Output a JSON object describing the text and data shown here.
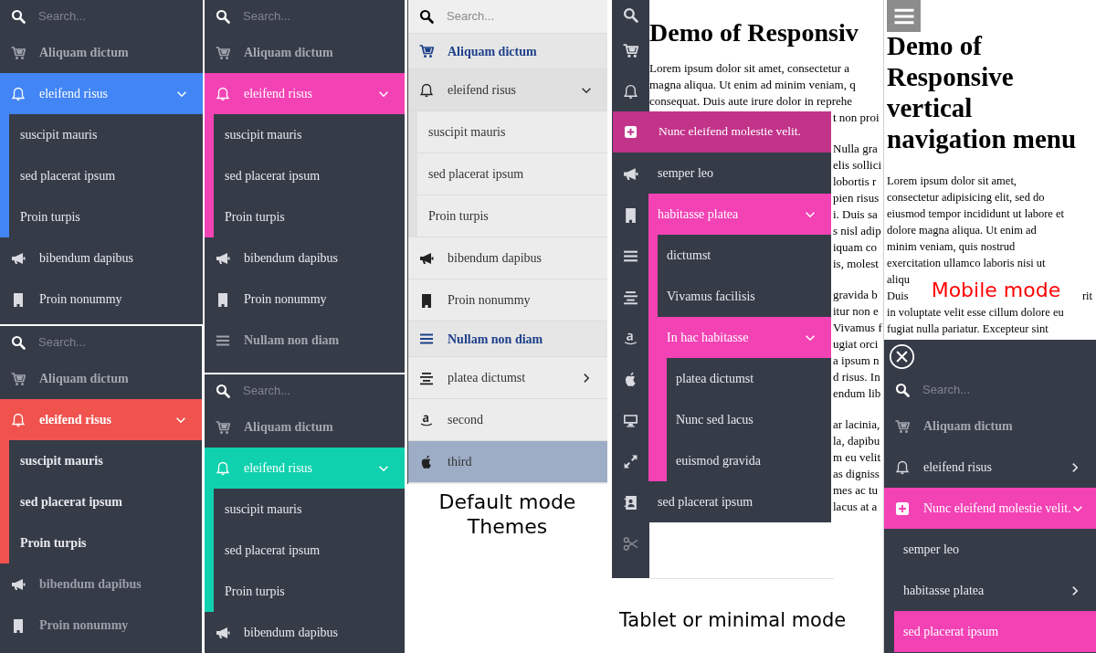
{
  "menus": [
    {
      "kind": "dark",
      "color": "#4285f4",
      "bold_text": false,
      "items": [
        {
          "kind": "search",
          "placeholder": "Search..."
        },
        {
          "kind": "header",
          "label": "Aliquam dictum"
        },
        {
          "kind": "link",
          "label": "eleifend risus",
          "expanded": true,
          "children": [
            {
              "label": "suscipit mauris"
            },
            {
              "label": "sed placerat ipsum"
            },
            {
              "label": "Proin turpis"
            }
          ]
        },
        {
          "kind": "link",
          "label": "bibendum dapibus"
        },
        {
          "kind": "link",
          "label": "Proin nonummy"
        }
      ]
    },
    {
      "kind": "dark",
      "color": "#f342b4",
      "bold_text": false,
      "items": [
        {
          "kind": "search",
          "placeholder": "Search..."
        },
        {
          "kind": "header",
          "label": "Aliquam dictum"
        },
        {
          "kind": "link",
          "label": "eleifend risus",
          "expanded": true,
          "children": [
            {
              "label": "suscipit mauris"
            },
            {
              "label": "sed placerat ipsum"
            },
            {
              "label": "Proin turpis"
            }
          ]
        },
        {
          "kind": "link",
          "label": "bibendum dapibus"
        },
        {
          "kind": "link",
          "label": "Proin nonummy"
        },
        {
          "kind": "header",
          "label": "Nullam non diam"
        }
      ]
    },
    {
      "kind": "dark",
      "color": "#f0534e",
      "bold_text": true,
      "items": [
        {
          "kind": "search",
          "placeholder": "Search..."
        },
        {
          "kind": "header",
          "label": "Aliquam dictum"
        },
        {
          "kind": "link",
          "label": "eleifend risus",
          "expanded": true,
          "children": [
            {
              "label": "suscipit mauris"
            },
            {
              "label": "sed placerat ipsum"
            },
            {
              "label": "Proin turpis"
            }
          ]
        },
        {
          "kind": "link",
          "label": "bibendum dapibus"
        },
        {
          "kind": "link",
          "label": "Proin nonummy"
        }
      ]
    },
    {
      "kind": "dark",
      "color": "#10d1ae",
      "bold_text": false,
      "items": [
        {
          "kind": "search",
          "placeholder": "Search..."
        },
        {
          "kind": "header",
          "label": "Aliquam dictum"
        },
        {
          "kind": "link",
          "label": "eleifend risus",
          "expanded": true,
          "children": [
            {
              "label": "suscipit mauris"
            },
            {
              "label": "sed placerat ipsum"
            },
            {
              "label": "Proin turpis"
            }
          ]
        },
        {
          "kind": "link",
          "label": "bibendum dapibus"
        }
      ]
    },
    {
      "kind": "light",
      "color": "#1d3f8a",
      "bold_text": false,
      "items": [
        {
          "kind": "search",
          "placeholder": "Search..."
        },
        {
          "kind": "header",
          "label": "Aliquam dictum"
        },
        {
          "kind": "link",
          "label": "eleifend risus",
          "expanded": true,
          "selected": false,
          "children": [
            {
              "label": "suscipit mauris",
              "selected": false
            },
            {
              "label": "sed placerat ipsum",
              "selected": false
            },
            {
              "label": "Proin turpis",
              "selected": false
            }
          ]
        },
        {
          "kind": "link",
          "label": "bibendum dapibus",
          "selected": false
        },
        {
          "kind": "link",
          "label": "Proin nonummy",
          "selected": false
        },
        {
          "kind": "header",
          "label": "Nullam non diam"
        },
        {
          "kind": "link",
          "label": "platea dictumst",
          "expanded": false,
          "selected": false
        },
        {
          "kind": "link",
          "label": "second",
          "selected": false
        },
        {
          "kind": "link",
          "label": "third",
          "selected": true
        }
      ]
    }
  ],
  "default_caption": "Default mode Themes",
  "tablet": {
    "title": "Demo of Responsiv",
    "lines": [
      "Lorem ipsum dolor sit amet, consectetur a",
      "magna aliqua. Ut enim ad minim veniam, q",
      "consequat. Duis aute irure dolor in reprehe"
    ],
    "fragments": [
      [
        "t non proi"
      ],
      [
        "Nulla gra",
        "elis sollici",
        "lobortis r",
        "pien risus",
        "i. Duis sa",
        "s nisl adip",
        "iquam co",
        "is, molest"
      ],
      [
        "gravida b",
        "itur non e",
        "Vivamus f",
        "ugiat orci",
        "a ipsum n",
        "d risus. In",
        "endum lib"
      ],
      [
        "ar lacinia,",
        "la, dapibu",
        "m eu velit",
        "as digniss",
        "mes ac tu",
        "lacus at a"
      ]
    ],
    "flyout": {
      "label": "Nunc eleifend molestie velit.",
      "color": "#c2338a",
      "children": [
        {
          "label": "semper leo"
        },
        {
          "label": "habitasse platea",
          "expanded": true,
          "color": "#f342b4",
          "children": [
            {
              "label": "dictumst"
            },
            {
              "label": "Vivamus facilisis"
            },
            {
              "label": "In hac habitasse",
              "expanded": true,
              "color": "#f342b4",
              "children": [
                {
                  "label": "platea dictumst"
                },
                {
                  "label": "Nunc sed lacus"
                },
                {
                  "label": "euismod gravida"
                }
              ]
            }
          ]
        },
        {
          "label": "sed placerat ipsum"
        }
      ]
    },
    "caption": "Tablet or minimal mode"
  },
  "mobile": {
    "title": "Demo of Responsive vertical navigation menu",
    "lines": [
      "Lorem ipsum dolor sit amet,",
      "consectetur adipisicing elit, sed do",
      "eiusmod tempor incididunt ut labore et",
      "dolore magna aliqua. Ut enim ad",
      "minim veniam, quis nostrud",
      "exercitation ullamco laboris nisi ut"
    ],
    "covered_left": [
      "aliqu",
      "Duis"
    ],
    "covered_right": "rit",
    "label": "Mobile mode",
    "lines_after": [
      "in voluptate velit esse cillum dolore eu",
      "fugiat nulla pariatur. Excepteur sint"
    ],
    "menu": {
      "items": [
        {
          "kind": "search",
          "placeholder": "Search..."
        },
        {
          "kind": "header",
          "label": "Aliquam dictum"
        },
        {
          "kind": "link",
          "label": "eleifend risus",
          "expanded": false
        },
        {
          "kind": "link",
          "label": "Nunc eleifend molestie velit.",
          "expanded": true,
          "color": "#f342b4",
          "children": [
            {
              "label": "semper leo",
              "selected": false
            },
            {
              "label": "habitasse platea",
              "expanded": false,
              "selected": false
            },
            {
              "label": "sed placerat ipsum",
              "selected": true,
              "color": "#f342b4"
            }
          ]
        }
      ]
    }
  }
}
